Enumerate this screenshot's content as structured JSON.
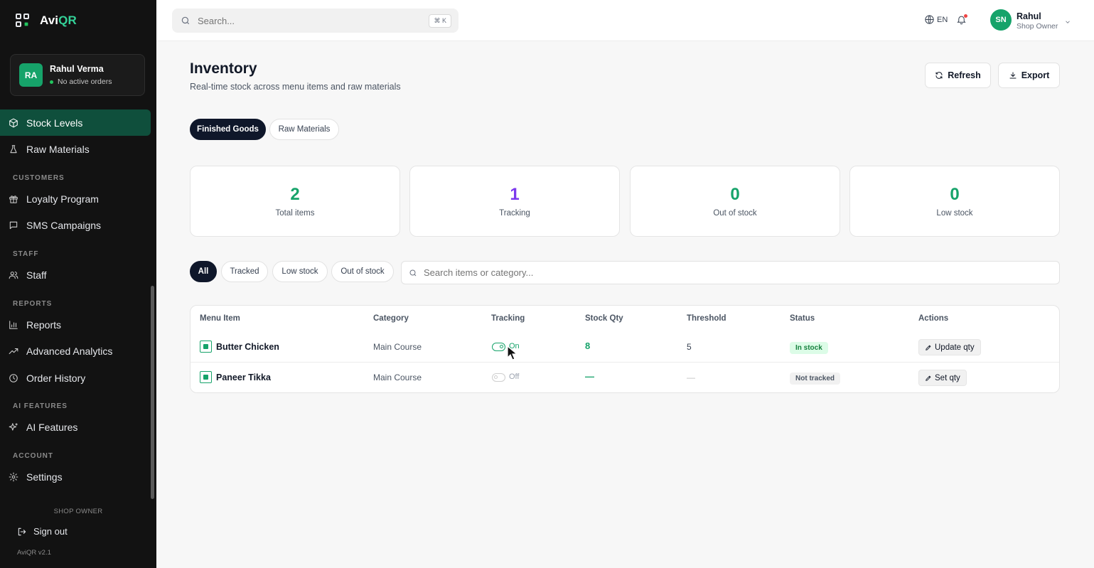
{
  "app": {
    "logo_prefix": "Avi",
    "logo_suffix": "QR"
  },
  "sidebar": {
    "user": {
      "initials": "RA",
      "name": "Rahul Verma",
      "status": "No active orders"
    },
    "items": {
      "stock_levels": "Stock Levels",
      "raw_materials": "Raw Materials",
      "loyalty": "Loyalty Program",
      "sms": "SMS Campaigns",
      "staff": "Staff",
      "reports": "Reports",
      "analytics": "Advanced Analytics",
      "history": "Order History",
      "ai": "AI Features",
      "settings": "Settings"
    },
    "sections": {
      "customers": "CUSTOMERS",
      "staff": "STAFF",
      "reports": "REPORTS",
      "ai": "AI FEATURES",
      "account": "ACCOUNT"
    },
    "footer": {
      "role": "SHOP OWNER",
      "signout": "Sign out",
      "version": "AviQR v2.1"
    },
    "accent_color": "#0f4f3c"
  },
  "topbar": {
    "search_placeholder": "Search...",
    "shortcut": "⌘ K",
    "language": "EN",
    "user": {
      "initials": "SN",
      "name": "Rahul",
      "role": "Shop Owner"
    }
  },
  "page": {
    "title": "Inventory",
    "subtitle": "Real-time stock across menu items and raw materials",
    "refresh_label": "Refresh",
    "export_label": "Export",
    "tabs": {
      "finished": "Finished Goods",
      "raw": "Raw Materials"
    },
    "stats": {
      "total": {
        "value": "2",
        "label": "Total items",
        "color": "#16a36a"
      },
      "tracking": {
        "value": "1",
        "label": "Tracking",
        "color": "#7c3aed"
      },
      "out": {
        "value": "0",
        "label": "Out of stock",
        "color": "#16a36a"
      },
      "low": {
        "value": "0",
        "label": "Low stock",
        "color": "#16a36a"
      }
    },
    "filters": {
      "all": "All",
      "tracked": "Tracked",
      "low": "Low stock",
      "out": "Out of stock"
    },
    "search_placeholder": "Search items or category...",
    "table": {
      "headers": {
        "item": "Menu Item",
        "category": "Category",
        "tracking": "Tracking",
        "qty": "Stock Qty",
        "threshold": "Threshold",
        "status": "Status",
        "actions": "Actions"
      },
      "rows": [
        {
          "name": "Butter Chicken",
          "category": "Main Course",
          "tracking": "On",
          "qty": "8",
          "threshold": "5",
          "status": "In stock",
          "action": "Update qty"
        },
        {
          "name": "Paneer Tikka",
          "category": "Main Course",
          "tracking": "Off",
          "qty": "—",
          "threshold": "—",
          "status": "Not tracked",
          "action": "Set qty"
        }
      ]
    }
  }
}
